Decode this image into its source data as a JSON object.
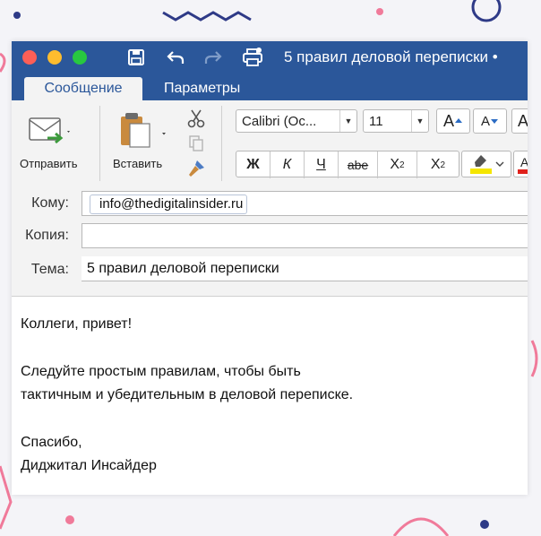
{
  "window": {
    "title": "5 правил деловой переписки •"
  },
  "tabs": [
    {
      "label": "Сообщение",
      "active": true
    },
    {
      "label": "Параметры",
      "active": false
    }
  ],
  "ribbon": {
    "send_label": "Отправить",
    "paste_label": "Вставить",
    "font_name": "Calibri (Oc...",
    "font_size": "11",
    "grow_font": "A",
    "shrink_font": "A",
    "bold": "Ж",
    "italic": "К",
    "underline": "Ч",
    "strikethrough": "abe",
    "subscript": "X",
    "subscript_mark": "2",
    "superscript": "X",
    "superscript_mark": "2",
    "highlight_color": "#f5e600",
    "font_color": "#e0201b"
  },
  "headers": {
    "to_label": "Кому:",
    "to_value": "info@thedigitalinsider.ru",
    "cc_label": "Копия:",
    "cc_value": "",
    "subject_label": "Тема:",
    "subject_value": "5 правил деловой переписки"
  },
  "body": {
    "lines": [
      "Коллеги, привет!",
      "Следуйте простым правилам, чтобы быть",
      "тактичным и убедительным в деловой переписке.",
      "Спасибо,",
      "Диджитал Инсайдер"
    ]
  },
  "colors": {
    "accent": "#2b579a",
    "decor_navy": "#2e3a87",
    "decor_pink": "#f07a9a"
  }
}
